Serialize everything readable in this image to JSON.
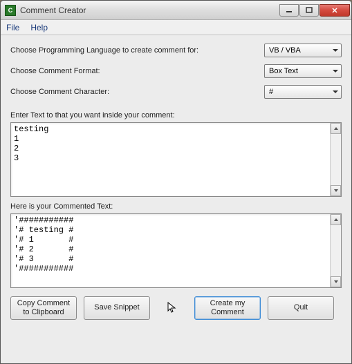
{
  "window": {
    "title": "Comment Creator"
  },
  "menu": {
    "file": "File",
    "help": "Help"
  },
  "form": {
    "lang_label": "Choose Programming Language to create comment for:",
    "lang_value": "VB / VBA",
    "format_label": "Choose Comment Format:",
    "format_value": "Box Text",
    "char_label": "Choose Comment Character:",
    "char_value": "#"
  },
  "input_section": {
    "label": "Enter Text to that you want inside your comment:",
    "value": "testing\n1\n2\n3"
  },
  "output_section": {
    "label": "Here is your Commented Text:",
    "value": "'###########\n'# testing #\n'# 1       #\n'# 2       #\n'# 3       #\n'###########"
  },
  "buttons": {
    "copy": "Copy Comment\nto Clipboard",
    "save": "Save Snippet",
    "create": "Create my\nComment",
    "quit": "Quit"
  }
}
